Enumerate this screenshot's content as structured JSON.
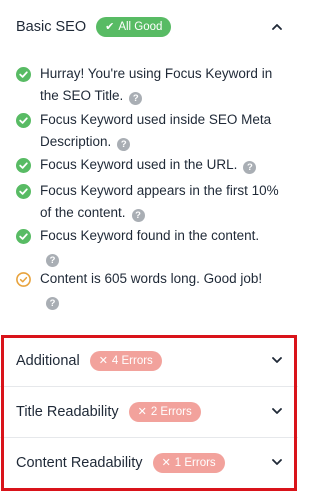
{
  "basic_seo": {
    "title": "Basic SEO",
    "badge_icon": "check-icon",
    "badge_label": "All Good",
    "chevron": "chevron-up-icon",
    "checks": [
      {
        "status": "pass",
        "line1": "Hurray! You're using Focus Keyword in",
        "line2": "the SEO Title."
      },
      {
        "status": "pass",
        "line1": "Focus Keyword used inside SEO Meta",
        "line2": "Description."
      },
      {
        "status": "pass",
        "line1": "Focus Keyword used in the URL.",
        "line2": ""
      },
      {
        "status": "pass",
        "line1": "Focus Keyword appears in the first 10%",
        "line2": "of the content."
      },
      {
        "status": "pass",
        "line1": "Focus Keyword found in the content.",
        "line2": ""
      },
      {
        "status": "warning",
        "line1": "Content is 605 words long. Good job!",
        "line2": ""
      }
    ]
  },
  "sections": [
    {
      "title": "Additional",
      "badge_label": "4 Errors",
      "chevron": "chevron-down-icon"
    },
    {
      "title": "Title Readability",
      "badge_label": "2 Errors",
      "chevron": "chevron-down-icon"
    },
    {
      "title": "Content Readability",
      "badge_label": "1 Errors",
      "chevron": "chevron-down-icon"
    }
  ],
  "colors": {
    "pass": "#58bb64",
    "warning": "#e8a33d",
    "error_badge": "#f2a29c",
    "highlight": "#d9131a",
    "help": "#a9aeb4"
  }
}
